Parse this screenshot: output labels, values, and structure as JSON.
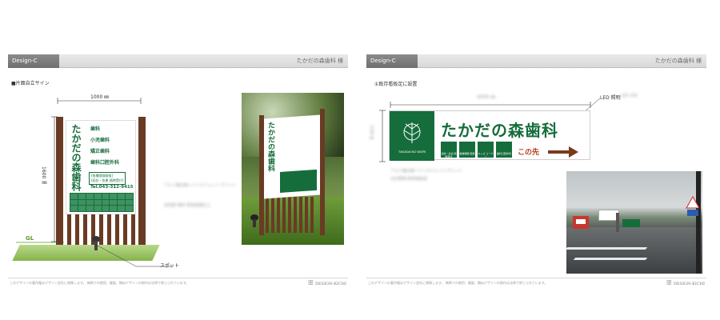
{
  "left_sheet": {
    "design_tag": "Design-C",
    "client": "たかだの森歯科 様",
    "section_title": "■片面自立サイン",
    "width_dim": "1000 ㎜",
    "height_dim": "1600 ㎜",
    "gl_label": "GL",
    "spot_label": "スポット",
    "sign": {
      "title": "たかだの森歯科",
      "services": [
        "歯科",
        "小児歯科",
        "矯正歯科",
        "歯科口腔外科"
      ],
      "hours": "[各種保険取扱]\n[初診・急患 随時受付]",
      "tel": "Tel.043-312-9415"
    },
    "blur_spec_1": "アルミ複合板＋インクジェットプリント",
    "blur_spec_2": "支柱部 角材 茶色塗装仕上",
    "footer_note": "このデザインの著作権はデザイン会社に帰属します。 無断での使用、複製、類似デザインの制作は法律で禁じられています。",
    "logo": "DESIGN-KICHI"
  },
  "right_sheet": {
    "design_tag": "Design-C",
    "client": "たかだの森歯科 様",
    "section_title": "①既存看板足に設置",
    "width_dim": "4000 ㎜",
    "height_dim": "1200 ㎜",
    "led_label": "LED 照明",
    "banner": {
      "title": "たかだの森歯科",
      "icons": [
        "初診・急患 随時受付",
        "各種保険 取扱",
        "キッズ コーナー",
        "歯科口腔外科"
      ],
      "next": "この先"
    },
    "blur_spec_1": "アルミ複合板＋インクジェットプリント",
    "blur_spec_2": "LED照明 既存看板足",
    "footer_note": "このデザインの著作権はデザイン会社に帰属します。 無断での使用、複製、類似デザインの制作は法律で禁じられています。",
    "logo": "DESIGN-KICHI"
  },
  "colors": {
    "brand_green": "#166d3c",
    "wood_brown": "#6a3b24",
    "arrow_red": "#b53b1c"
  }
}
